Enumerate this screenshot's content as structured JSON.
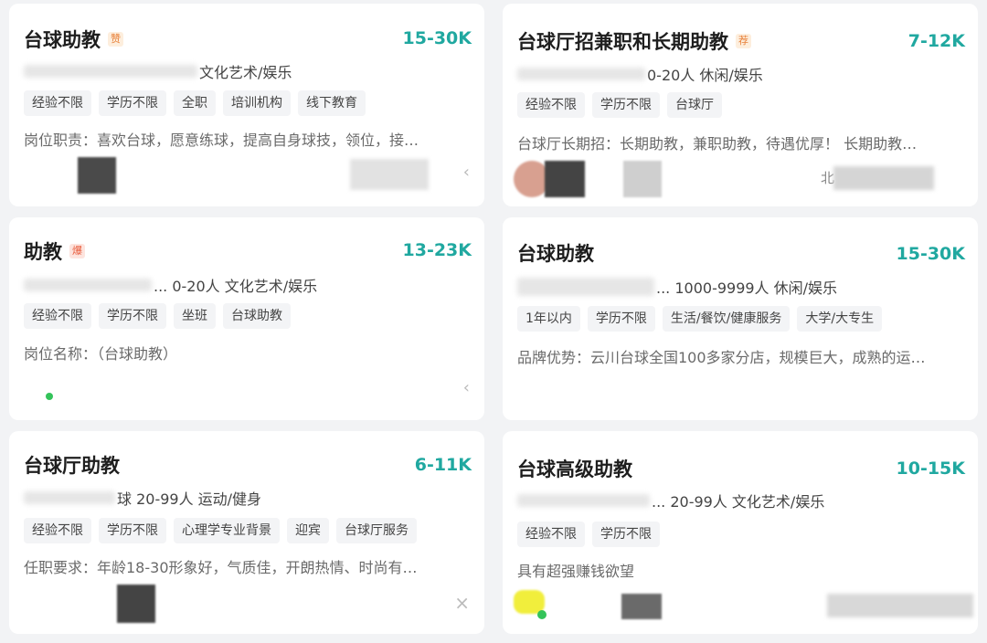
{
  "cards": [
    {
      "title": "台球助教",
      "badge": "赞",
      "salary": "15-30K",
      "company": "文化艺术/娱乐",
      "tags": [
        "经验不限",
        "学历不限",
        "全职",
        "培训机构",
        "线下教育"
      ],
      "desc": "岗位职责：喜欢台球，愿意练球，提高自身球技，领位，接…"
    },
    {
      "title": "台球厅招兼职和长期助教",
      "badge": "荐",
      "salary": "7-12K",
      "company": "0-20人 休闲/娱乐",
      "tags": [
        "经验不限",
        "学历不限",
        "台球厅"
      ],
      "desc": "台球厅长期招：长期助教，兼职助教，待遇优厚！ 长期助教…",
      "footer_text": "北"
    },
    {
      "title": "助教",
      "badge": "爆",
      "salary": "13-23K",
      "company": "... 0-20人 文化艺术/娱乐",
      "tags": [
        "经验不限",
        "学历不限",
        "坐班",
        "台球助教"
      ],
      "desc": "岗位名称：（台球助教）"
    },
    {
      "title": "台球助教",
      "salary": "15-30K",
      "company": "... 1000-9999人 休闲/娱乐",
      "tags": [
        "1年以内",
        "学历不限",
        "生活/餐饮/健康服务",
        "大学/大专生"
      ],
      "desc": "品牌优势：云川台球全国100多家分店，规模巨大，成熟的运…"
    },
    {
      "title": "台球厅助教",
      "salary": "6-11K",
      "company": "球 20-99人 运动/健身",
      "tags": [
        "经验不限",
        "学历不限",
        "心理学专业背景",
        "迎宾",
        "台球厅服务"
      ],
      "desc": "任职要求：年龄18-30形象好，气质佳，开朗热情、时尚有…"
    },
    {
      "title": "台球高级助教",
      "salary": "10-15K",
      "company": "... 20-99人 文化艺术/娱乐",
      "tags": [
        "经验不限",
        "学历不限"
      ],
      "desc": "具有超强赚钱欲望"
    }
  ],
  "icons": {
    "chevron": "‹",
    "close": "×"
  },
  "colors": {
    "salary": "#20a8a0",
    "badge_zan": "#e8813a",
    "badge_jian": "#e8813a",
    "badge_bao": "#e85a3a"
  }
}
